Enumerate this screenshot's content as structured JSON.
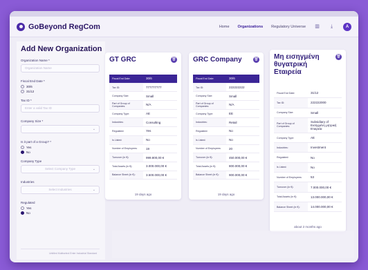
{
  "app": {
    "brand": "GoBeyond RegCom",
    "nav": [
      "Home",
      "Organizations",
      "Regulatory Universe"
    ],
    "active_nav": "Organizations",
    "avatar_initial": "A",
    "icons": [
      "chart-icon",
      "download-icon"
    ]
  },
  "form": {
    "title": "Add New Organization",
    "org_name_label": "Organization Name *",
    "org_name_placeholder": "Organization Name",
    "fiscal_label": "Fiscal End Date *",
    "fiscal_options": [
      "30/6",
      "31/12"
    ],
    "tax_label": "Tax ID *",
    "tax_placeholder": "Enter a valid Tax ID",
    "size_label": "Company Size *",
    "group_label": "Is it part of a Group? *",
    "group_options": [
      "Yes",
      "No"
    ],
    "group_selected": "No",
    "type_label": "Company Type",
    "type_placeholder": "Select Company Type",
    "industries_label": "Industries",
    "industries_placeholder": "Select Industries",
    "regulated_label": "Regulated",
    "regulated_options": [
      "Yes",
      "No"
    ],
    "regulated_selected": "No",
    "footer_hint": "Untitled Multiselect Enter Industrial Standard"
  },
  "cards": [
    {
      "title": "GT GRC",
      "rows": [
        {
          "k": "Fiscal End Date:",
          "v": "30/6",
          "hdr": true
        },
        {
          "k": "Tax ID:",
          "v": "777777777"
        },
        {
          "k": "Company Size:",
          "v": "Small"
        },
        {
          "k": "Part of Group of Companies:",
          "v": "N/A"
        },
        {
          "k": "Company Type:",
          "v": "AE"
        },
        {
          "k": "Industries:",
          "v": "Consulting"
        },
        {
          "k": "Regulated:",
          "v": "Yes"
        },
        {
          "k": "Is Listed:",
          "v": "No"
        },
        {
          "k": "Number of Employees:",
          "v": "19"
        },
        {
          "k": "Turnover (in €):",
          "v": "999.800,00 €"
        },
        {
          "k": "Total Assets (in €):",
          "v": "3.000.000,00 €"
        },
        {
          "k": "Balance Sheet (in €):",
          "v": "3.500.000,00 €"
        }
      ],
      "footer": "19 days ago"
    },
    {
      "title": "GRC Company",
      "rows": [
        {
          "k": "Fiscal End Date:",
          "v": "30/6",
          "hdr": true
        },
        {
          "k": "Tax ID:",
          "v": "222222222"
        },
        {
          "k": "Company Size:",
          "v": "Small"
        },
        {
          "k": "Part of Group of Companies:",
          "v": "N/A"
        },
        {
          "k": "Company Type:",
          "v": "EE"
        },
        {
          "k": "Industries:",
          "v": "Retail"
        },
        {
          "k": "Regulated:",
          "v": "No"
        },
        {
          "k": "Is Listed:",
          "v": "No"
        },
        {
          "k": "Number of Employees:",
          "v": "20"
        },
        {
          "k": "Turnover (in €):",
          "v": "450.000,00 €"
        },
        {
          "k": "Total Assets (in €):",
          "v": "800.000,00 €"
        },
        {
          "k": "Balance Sheet (in €):",
          "v": "900.000,00 €"
        }
      ],
      "footer": "19 days ago"
    },
    {
      "title": "Μη εισηγμένη θυγατρική Εταιρεία",
      "rows": [
        {
          "k": "Fiscal End Date:",
          "v": "31/12"
        },
        {
          "k": "Tax ID:",
          "v": "222222000"
        },
        {
          "k": "Company Size:",
          "v": "Small"
        },
        {
          "k": "Part of Group of Companies:",
          "v": "Subsidiary of Εισηγμένη μητρική Εταιρεία"
        },
        {
          "k": "Company Type:",
          "v": "AE"
        },
        {
          "k": "Industries:",
          "v": "Investment"
        },
        {
          "k": "Regulated:",
          "v": "No"
        },
        {
          "k": "Is Listed:",
          "v": "No"
        },
        {
          "k": "Number of Employees:",
          "v": "53"
        },
        {
          "k": "Turnover (in €):",
          "v": "7.000.000,00 €"
        },
        {
          "k": "Total Assets (in €):",
          "v": "13.000.000,00 €"
        },
        {
          "k": "Balance Sheet (in €):",
          "v": "14.000.000,00 €"
        }
      ],
      "footer": "about 2 months ago"
    }
  ]
}
